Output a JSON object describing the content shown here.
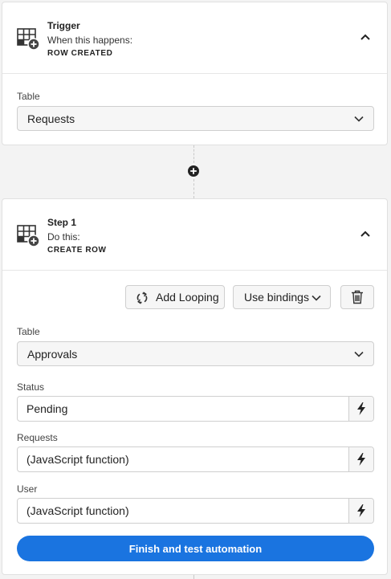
{
  "trigger": {
    "title": "Trigger",
    "subtitle": "When this happens:",
    "action": "ROW CREATED",
    "table_label": "Table",
    "table_value": "Requests"
  },
  "step1": {
    "title": "Step 1",
    "subtitle": "Do this:",
    "action": "CREATE ROW",
    "add_looping_label": "Add Looping",
    "use_bindings_label": "Use bindings",
    "table_label": "Table",
    "table_value": "Approvals",
    "fields": [
      {
        "label": "Status",
        "value": "Pending"
      },
      {
        "label": "Requests",
        "value": "(JavaScript function)"
      },
      {
        "label": "User",
        "value": "(JavaScript function)"
      }
    ],
    "finish_label": "Finish and test automation"
  },
  "icons": {
    "block": "table-add-icon",
    "collapse": "chevron-up-icon",
    "dropdown": "chevron-down-icon",
    "bindings": "lightning-icon",
    "delete": "trash-icon",
    "loop": "loop-icon",
    "add_step": "plus-circle-icon"
  },
  "colors": {
    "primary": "#1a74e0",
    "background": "#f3f3f3",
    "card": "#ffffff"
  }
}
